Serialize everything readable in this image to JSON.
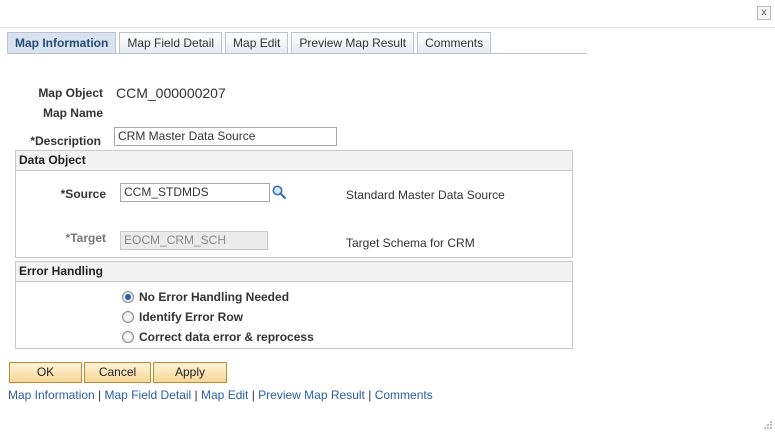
{
  "window": {
    "close_label": "x"
  },
  "tabs": [
    {
      "label": "Map Information",
      "active": true
    },
    {
      "label": "Map Field Detail",
      "active": false
    },
    {
      "label": "Map Edit",
      "active": false
    },
    {
      "label": "Preview Map Result",
      "active": false
    },
    {
      "label": "Comments",
      "active": false
    }
  ],
  "form": {
    "map_object_label": "Map Object",
    "map_object_value": "CCM_000000207",
    "map_name_label": "Map Name",
    "description_label": "*Description",
    "description_value": "CRM Master Data Source"
  },
  "data_object": {
    "title": "Data Object",
    "source_label": "*Source",
    "source_value": "CCM_STDMDS",
    "source_desc": "Standard Master Data Source",
    "target_label": "*Target",
    "target_value": "EOCM_CRM_SCH",
    "target_desc": "Target Schema for CRM"
  },
  "error_handling": {
    "title": "Error Handling",
    "options": [
      {
        "label": "No Error Handling Needed",
        "selected": true
      },
      {
        "label": "Identify Error Row",
        "selected": false
      },
      {
        "label": "Correct data error & reprocess",
        "selected": false
      }
    ]
  },
  "buttons": {
    "ok": "OK",
    "cancel": "Cancel",
    "apply": "Apply"
  },
  "footer_links": [
    "Map Information",
    "Map Field Detail",
    "Map Edit",
    "Preview Map Result",
    "Comments"
  ],
  "footer_separator": " | ",
  "colors": {
    "link": "#2a5ea8",
    "button_bg": "#f7d797",
    "tab_active": "#d7e3f1"
  },
  "icons": {
    "lookup": "magnifier-icon",
    "close": "close-icon"
  }
}
